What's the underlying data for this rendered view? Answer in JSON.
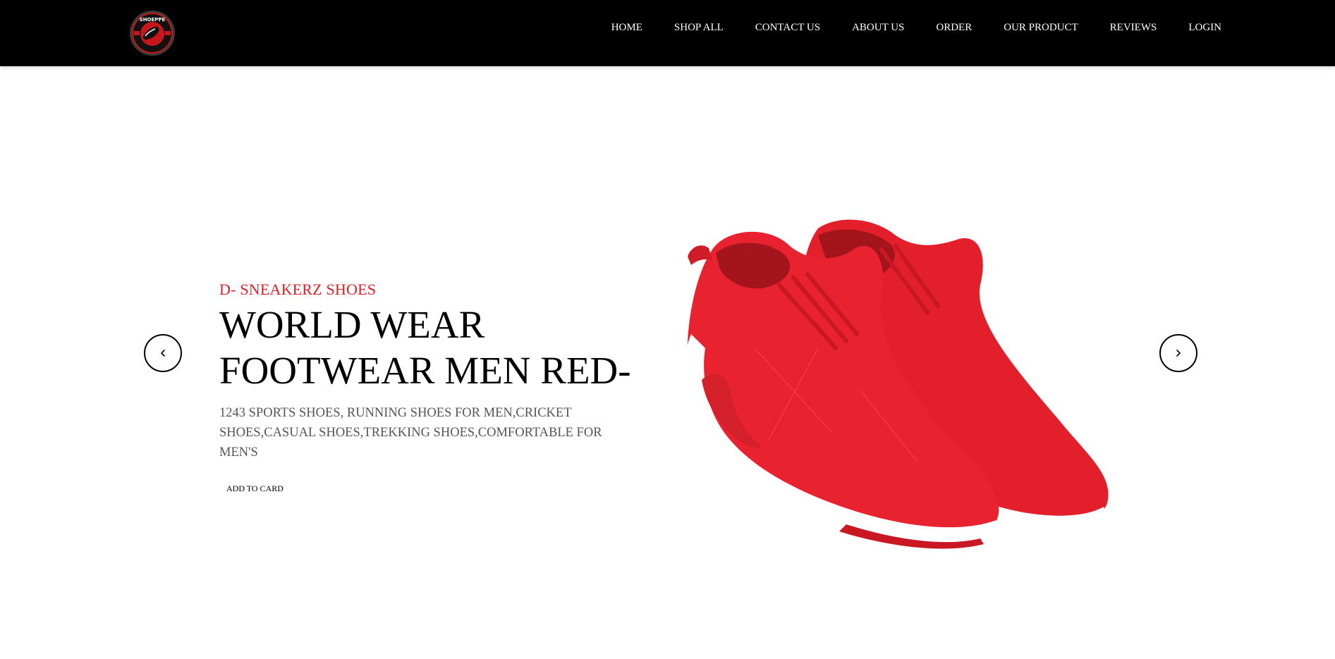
{
  "header": {
    "logo_icon": "brand-logo",
    "logo_text": "SHOEPPE",
    "nav": [
      {
        "label": "HOME"
      },
      {
        "label": "SHOP ALL"
      },
      {
        "label": "CONTACT US"
      },
      {
        "label": "ABOUT US"
      },
      {
        "label": "ORDER"
      },
      {
        "label": "OUR PRODUCT"
      },
      {
        "label": "REVIEWS"
      },
      {
        "label": "LOGIN"
      }
    ]
  },
  "hero": {
    "subtitle": "D- SNEAKERZ SHOES",
    "headline_line1": "WORLD WEAR",
    "headline_line2": "FOOTWEAR MEN RED-",
    "description": "1243 SPORTS SHOES, RUNNING SHOES FOR MEN,CRICKET SHOES,CASUAL SHOES,TREKKING SHOES,COMFORTABLE FOR MEN'S",
    "cta_label": "ADD TO CARD",
    "prev_icon": "chevron-left-icon",
    "next_icon": "chevron-right-icon",
    "image": "red-sneakers-image"
  },
  "colors": {
    "nav_bg": "#000000",
    "accent": "#e31b23",
    "text": "#000000",
    "muted": "#555555"
  }
}
